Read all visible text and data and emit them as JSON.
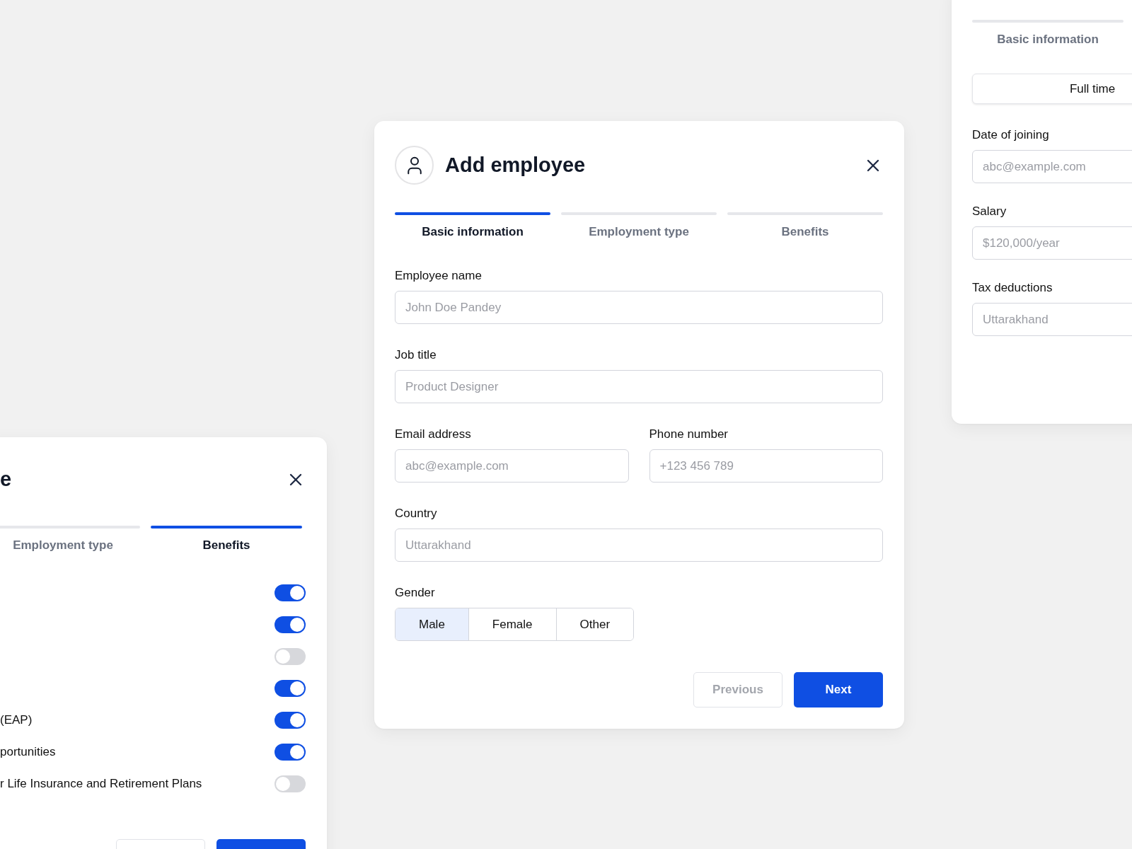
{
  "employment_dialog": {
    "tabs": [
      {
        "label": "Basic information",
        "selected": false
      }
    ],
    "employment_options": [
      {
        "label": "Full time",
        "selected": true
      }
    ],
    "fields": [
      {
        "label": "Date of joining",
        "placeholder": "abc@example.com"
      },
      {
        "label": "Salary",
        "placeholder": "$120,000/year"
      },
      {
        "label": "Tax deductions",
        "placeholder": "Uttarakhand"
      }
    ]
  },
  "add_employee_dialog": {
    "title": "Add employee",
    "tabs": [
      {
        "label": "Basic information",
        "selected": true
      },
      {
        "label": "Employment type",
        "selected": false
      },
      {
        "label": "Benefits",
        "selected": false
      }
    ],
    "field_rows": [
      [
        {
          "label": "Employee name",
          "placeholder": "John Doe Pandey"
        }
      ],
      [
        {
          "label": "Job title",
          "placeholder": "Product Designer"
        }
      ],
      [
        {
          "label": "Email address",
          "placeholder": "abc@example.com"
        },
        {
          "label": "Phone number",
          "placeholder": "+123 456 789"
        }
      ],
      [
        {
          "label": "Country",
          "placeholder": "Uttarakhand"
        }
      ]
    ],
    "gender": {
      "label": "Gender",
      "options": [
        {
          "label": "Male",
          "selected": true
        },
        {
          "label": "Female",
          "selected": false
        },
        {
          "label": "Other",
          "selected": false
        }
      ]
    },
    "buttons": [
      {
        "label": "Previous",
        "kind": "secondary",
        "disabled": true
      },
      {
        "label": "Next",
        "kind": "primary",
        "disabled": false
      }
    ]
  },
  "benefits_dialog": {
    "title": "e",
    "tabs": [
      {
        "label": "Employment type",
        "selected": false
      },
      {
        "label": "Benefits",
        "selected": true
      }
    ],
    "rows": [
      {
        "on": true
      },
      {
        "on": true
      },
      {
        "on": false
      },
      {
        "on": true
      },
      {
        "label": "(EAP)",
        "on": true
      },
      {
        "label": "portunities",
        "on": true
      },
      {
        "label": "r Life Insurance and Retirement Plans",
        "on": false
      }
    ],
    "buttons": [
      {
        "kind": "secondary"
      },
      {
        "kind": "primary"
      }
    ]
  }
}
